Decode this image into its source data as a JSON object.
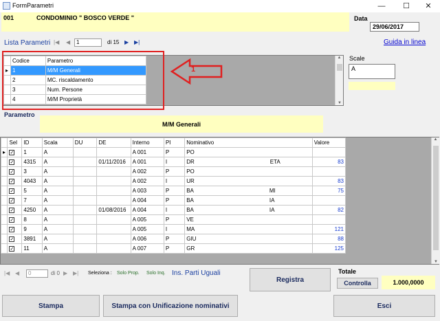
{
  "window": {
    "title": "FormParametri",
    "buttons": [
      "—",
      "☐",
      "✕"
    ]
  },
  "header": {
    "code": "001",
    "condominio": "CONDOMINIO \" BOSCO VERDE \"",
    "date_label": "Data",
    "date_value": "29/06/2017"
  },
  "params_nav": {
    "label": "Lista Parametri",
    "page": "1",
    "page_of": "di 15",
    "help_link": "Guida in linea"
  },
  "params_table": {
    "columns": [
      "Codice",
      "Parametro"
    ],
    "rows": [
      {
        "code": "1",
        "name": "M/M Generali",
        "selected": true
      },
      {
        "code": "2",
        "name": "MC. riscaldamento",
        "selected": false
      },
      {
        "code": "3",
        "name": "Num. Persone",
        "selected": false
      },
      {
        "code": "4",
        "name": "M/M Proprietà",
        "selected": false
      }
    ]
  },
  "annotation": {
    "number": "1",
    "color": "#e02020"
  },
  "scale": {
    "label": "Scale",
    "value": "A"
  },
  "parametro": {
    "label": "Parametro",
    "value": "M/M Generali"
  },
  "main_table": {
    "columns": [
      "Sel",
      "ID",
      "Scala",
      "DU",
      "DE",
      "Interno",
      "PI",
      "Nominativo",
      "Valore"
    ],
    "rows": [
      {
        "id": "1",
        "scala": "A",
        "du": "",
        "de": "",
        "interno": "A 001",
        "pi": "P",
        "nome": "PO",
        "tail": "",
        "valore": ""
      },
      {
        "id": "4315",
        "scala": "A",
        "du": "",
        "de": "01/11/2016",
        "interno": "A 001",
        "pi": "I",
        "nome": "DR",
        "tail": "ETA",
        "valore": "83"
      },
      {
        "id": "3",
        "scala": "A",
        "du": "",
        "de": "",
        "interno": "A 002",
        "pi": "P",
        "nome": "PO",
        "tail": "",
        "valore": ""
      },
      {
        "id": "4043",
        "scala": "A",
        "du": "",
        "de": "",
        "interno": "A 002",
        "pi": "I",
        "nome": "UR",
        "tail": "",
        "valore": "83"
      },
      {
        "id": "5",
        "scala": "A",
        "du": "",
        "de": "",
        "interno": "A 003",
        "pi": "P",
        "nome": "BA",
        "tail": "MI",
        "valore": "75"
      },
      {
        "id": "7",
        "scala": "A",
        "du": "",
        "de": "",
        "interno": "A 004",
        "pi": "P",
        "nome": "BA",
        "tail": "IA",
        "valore": ""
      },
      {
        "id": "4250",
        "scala": "A",
        "du": "",
        "de": "01/08/2016",
        "interno": "A 004",
        "pi": "I",
        "nome": "BA",
        "tail": "IA",
        "valore": "82"
      },
      {
        "id": "8",
        "scala": "A",
        "du": "",
        "de": "",
        "interno": "A 005",
        "pi": "P",
        "nome": "VE",
        "tail": "",
        "valore": ""
      },
      {
        "id": "9",
        "scala": "A",
        "du": "",
        "de": "",
        "interno": "A 005",
        "pi": "I",
        "nome": "MA",
        "tail": "",
        "valore": "121"
      },
      {
        "id": "3891",
        "scala": "A",
        "du": "",
        "de": "",
        "interno": "A 006",
        "pi": "P",
        "nome": "GIU",
        "tail": "",
        "valore": "88"
      },
      {
        "id": "11",
        "scala": "A",
        "du": "",
        "de": "",
        "interno": "A 007",
        "pi": "P",
        "nome": "GR",
        "tail": "",
        "valore": "125"
      }
    ]
  },
  "bottom_nav": {
    "page": "0",
    "page_of": "di 0",
    "seleziona_label": "Seleziona :",
    "solo_prop": "Solo Prop.",
    "solo_inq": "Solo Inq.",
    "ins_parti": "Ins. Parti Uguali"
  },
  "buttons": {
    "registra": "Registra",
    "controlla": "Controlla",
    "stampa": "Stampa",
    "stampa_unif": "Stampa con Unificazione nominativi",
    "esci": "Esci"
  },
  "totale": {
    "label": "Totale",
    "value": "1.000,0000"
  }
}
